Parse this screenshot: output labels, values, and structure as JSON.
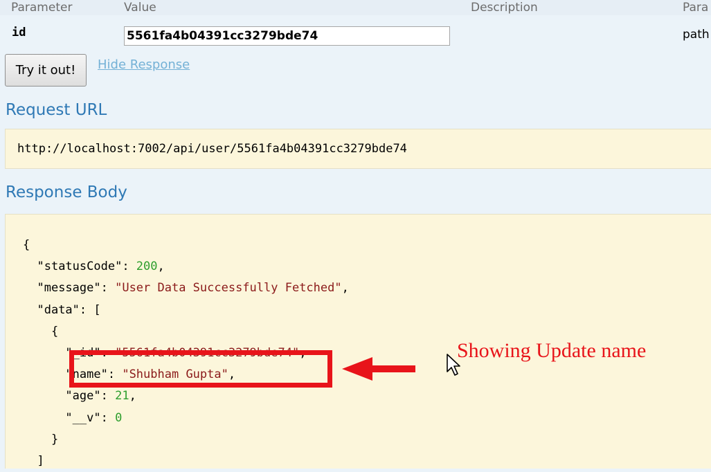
{
  "parameters_table": {
    "headers": [
      "Parameter",
      "Value",
      "Description",
      "Para"
    ],
    "rows": [
      {
        "name": "id",
        "value": "5561fa4b04391cc3279bde74",
        "type": "path"
      }
    ]
  },
  "actions": {
    "try_label": "Try it out!",
    "hide_response_label": "Hide Response"
  },
  "request_url": {
    "title": "Request URL",
    "url": "http://localhost:7002/api/user/5561fa4b04391cc3279bde74"
  },
  "response_body": {
    "title": "Response Body",
    "lines": [
      "{",
      "  \"statusCode\": 200,",
      "  \"message\": \"User Data Successfully Fetched\",",
      "  \"data\": [",
      "    {",
      "      \"_id\": \"5561fa4b04391cc3279bde74\",",
      "      \"name\": \"Shubham Gupta\",",
      "      \"age\": 21,",
      "      \"__v\": 0",
      "    }",
      "  ]"
    ]
  },
  "annotation": {
    "text": "Showing Update name",
    "color": "#e8141a"
  },
  "colors": {
    "section_title": "#2f79b5",
    "link": "#74b1d6",
    "code_background": "#fcf6db",
    "json_number": "#2d9e2d",
    "json_string": "#8b1a1a"
  },
  "icons": [
    "arrow-left-icon",
    "mouse-cursor-icon"
  ]
}
